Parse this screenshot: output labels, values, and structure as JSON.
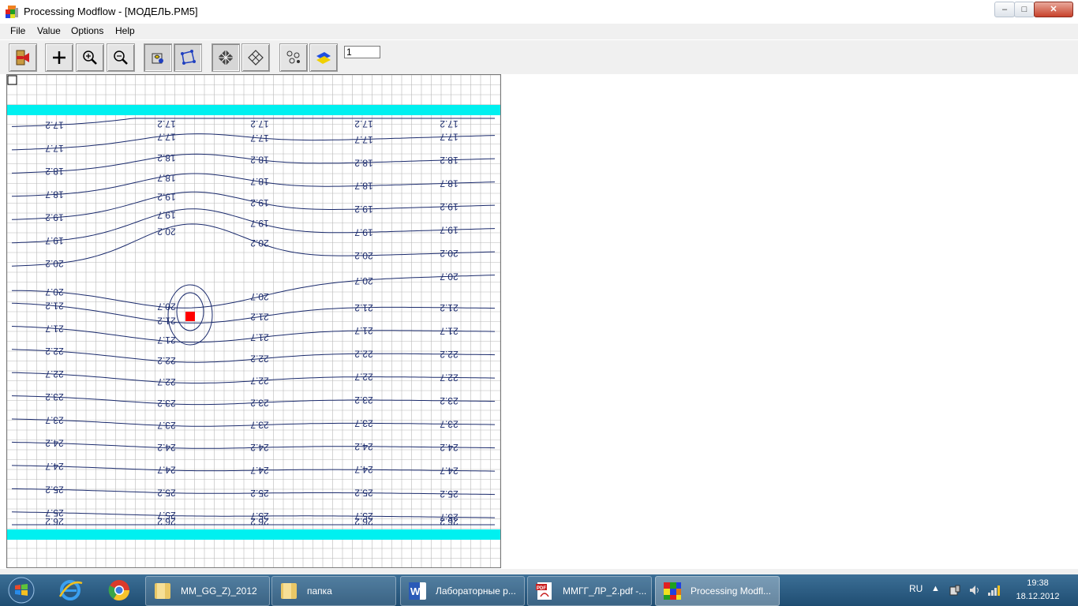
{
  "window": {
    "title": "Processing Modflow - [МОДЕЛЬ.PM5]",
    "min": "–",
    "max": "□",
    "close": "✕"
  },
  "menu": [
    "File",
    "Value",
    "Options",
    "Help"
  ],
  "toolbar": {
    "layer_value": "1",
    "buttons": [
      "exit-icon",
      "add-icon",
      "zoom-in-icon",
      "zoom-out-icon",
      "values-icon",
      "polygon-icon",
      "grid-icon",
      "cells-icon",
      "wells-icon",
      "layers-icon"
    ]
  },
  "model": {
    "colors": {
      "contour": "#1a2a6c",
      "boundary": "#00f0f0",
      "well": "#ff0000",
      "grid": "#b8b8b8"
    },
    "contour_labels": [
      "17.2",
      "17.7",
      "18.2",
      "18.7",
      "19.2",
      "19.7",
      "20.2",
      "20.7",
      "21.2",
      "21.7",
      "22.2",
      "22.7",
      "23.2",
      "23.7",
      "24.2",
      "24.7",
      "25.2",
      "25.7",
      "26.2"
    ]
  },
  "taskbar": {
    "tasks": [
      {
        "label": "MM_GG_Z)_2012",
        "icon": "folder-icon"
      },
      {
        "label": "папка",
        "icon": "folder-icon"
      },
      {
        "label": "Лабораторные р...",
        "icon": "word-icon"
      },
      {
        "label": "ММГГ_ЛР_2.pdf -...",
        "icon": "pdf-icon"
      },
      {
        "label": "Processing Modfl...",
        "icon": "pmwin-icon"
      }
    ],
    "lang": "RU",
    "time": "19:38",
    "date": "18.12.2012"
  }
}
